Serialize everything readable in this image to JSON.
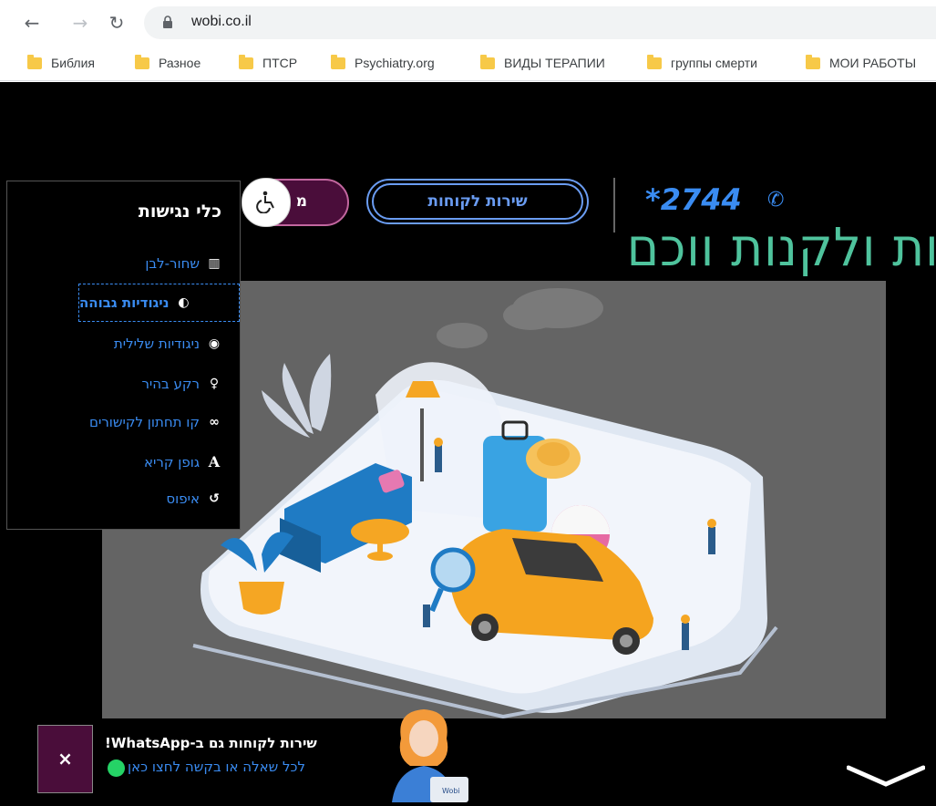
{
  "browser": {
    "url": "wobi.co.il",
    "bookmarks": [
      "Библия",
      "Разное",
      "ПТСР",
      "Psychiatry.org",
      "ВИДЫ ТЕРАПИИ",
      "группы смерти",
      "МОИ РАБОТЫ"
    ]
  },
  "header": {
    "hero_title": "ות ולקנות ווכם",
    "phone": "*2744",
    "customer_service_label": "שירות לקוחות",
    "login_label": "מ"
  },
  "accessibility_panel": {
    "title": "כלי נגישות",
    "items": [
      {
        "label": "שחור-לבן",
        "icon": "barcode-icon"
      },
      {
        "label": "ניגודיות גבוהה",
        "icon": "half-circle-icon"
      },
      {
        "label": "ניגודיות שלילית",
        "icon": "eye-icon"
      },
      {
        "label": "רקע בהיר",
        "icon": "lightbulb-icon"
      },
      {
        "label": "קו תחתון לקישורים",
        "icon": "link-icon"
      },
      {
        "label": "גופן קריא",
        "icon": "font-icon"
      },
      {
        "label": "איפוס",
        "icon": "reset-icon"
      }
    ]
  },
  "whatsapp_bar": {
    "close_label": "×",
    "title": "שירות לקוחות גם ב-WhatsApp!",
    "subtitle": "לכל שאלה או בקשה לחצו כאן",
    "badge_text": "Wobi"
  },
  "colors": {
    "accent_blue": "#3a8cf2",
    "hero_green": "#4fc39d",
    "brand_purple": "#4a0d3a",
    "whatsapp_green": "#25d366"
  }
}
